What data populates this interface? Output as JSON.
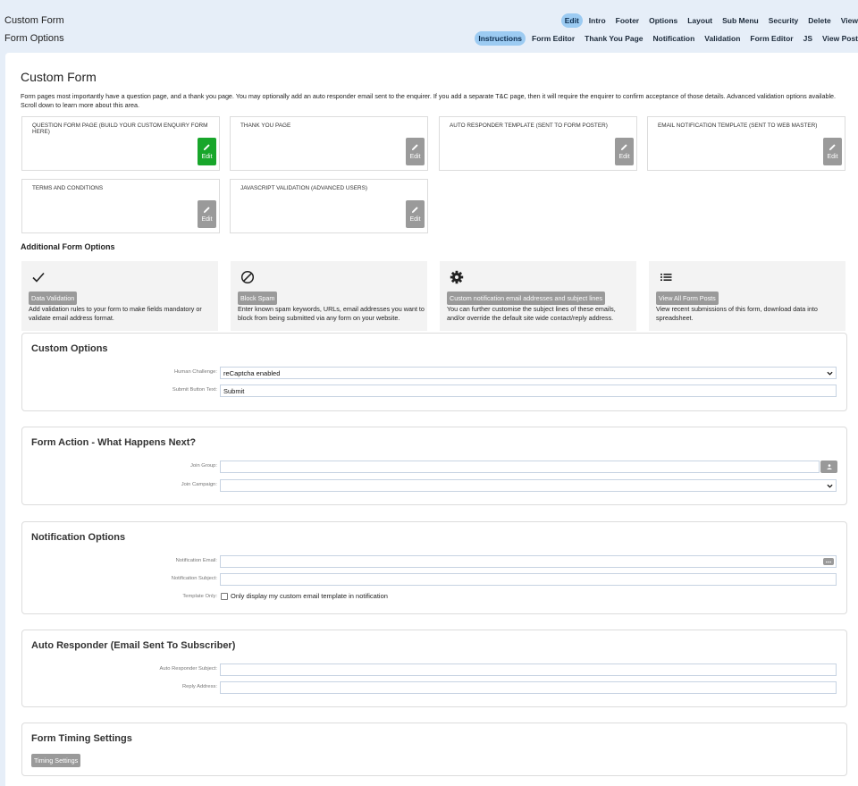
{
  "header": {
    "title": "Custom Form",
    "subtitle": "Form Options",
    "nav_primary": [
      {
        "label": "Edit",
        "active": true
      },
      {
        "label": "Intro",
        "active": false
      },
      {
        "label": "Footer",
        "active": false
      },
      {
        "label": "Options",
        "active": false
      },
      {
        "label": "Layout",
        "active": false
      },
      {
        "label": "Sub Menu",
        "active": false
      },
      {
        "label": "Security",
        "active": false
      },
      {
        "label": "Delete",
        "active": false
      },
      {
        "label": "View",
        "active": false
      }
    ],
    "nav_secondary": [
      {
        "label": "Instructions",
        "active": true
      },
      {
        "label": "Form Editor",
        "active": false
      },
      {
        "label": "Thank You Page",
        "active": false
      },
      {
        "label": "Notification",
        "active": false
      },
      {
        "label": "Validation",
        "active": false
      },
      {
        "label": "Form Editor",
        "active": false
      },
      {
        "label": "JS",
        "active": false
      },
      {
        "label": "View Post",
        "active": false
      }
    ]
  },
  "main": {
    "title": "Custom Form",
    "intro": "Form pages most importantly have a question page, and a thank you page. You may optionally add an auto responder email sent to the enquirer. If you add a separate T&C page, then it will require the enquirer to confirm acceptance of those details. Advanced validation options available. Scroll down to learn more about this area.",
    "edit_label": "Edit",
    "cards": [
      {
        "label": "Question form page (build your custom enquiry form here)",
        "active": true
      },
      {
        "label": "Thank you page",
        "active": false
      },
      {
        "label": "Auto responder template (sent to form poster)",
        "active": false
      },
      {
        "label": "Email notification template (sent to web master)",
        "active": false
      },
      {
        "label": "Terms and conditions",
        "active": false
      },
      {
        "label": "JavaScript Validation (Advanced Users)",
        "active": false
      }
    ]
  },
  "additional": {
    "heading": "Additional Form Options",
    "options": [
      {
        "icon": "check-icon",
        "button": "Data Validation",
        "desc": "Add validation rules to your form to make fields mandatory or validate email address format."
      },
      {
        "icon": "block-icon",
        "button": "Block Spam",
        "desc": "Enter known spam keywords, URLs, email addresses you want to block from being submitted via any form on your website."
      },
      {
        "icon": "gear-icon",
        "button": "Custom notification email addresses and subject lines",
        "desc": "You can further customise the subject lines of these emails, and/or override the default site wide contact/reply address."
      },
      {
        "icon": "list-icon",
        "button": "View All Form Posts",
        "desc": "View recent submissions of this form, download data into spreadsheet."
      }
    ]
  },
  "custom_options": {
    "title": "Custom Options",
    "human_label": "Human Challenge:",
    "human_value": "reCaptcha enabled",
    "submit_label": "Submit Button Text:",
    "submit_value": "Submit"
  },
  "form_action": {
    "title": "Form Action - What Happens Next?",
    "group_label": "Join Group:",
    "group_value": "",
    "campaign_label": "Join Campaign:",
    "campaign_value": ""
  },
  "notification": {
    "title": "Notification Options",
    "email_label": "Notification Email:",
    "email_value": "",
    "subject_label": "Notification Subject:",
    "subject_value": "",
    "template_label": "Template Only:",
    "template_text": "Only display my custom email template in notification"
  },
  "auto_responder": {
    "title": "Auto Responder (Email Sent To Subscriber)",
    "subject_label": "Auto Responder Subject:",
    "subject_value": "",
    "reply_label": "Reply Address:",
    "reply_value": ""
  },
  "timing": {
    "title": "Form Timing Settings",
    "button": "Timing Settings"
  },
  "colors": {
    "accent": "#9ccbf2",
    "page_bg": "#e6eef8",
    "edit_green": "#18a62b",
    "button_gray": "#9a9a9a"
  }
}
